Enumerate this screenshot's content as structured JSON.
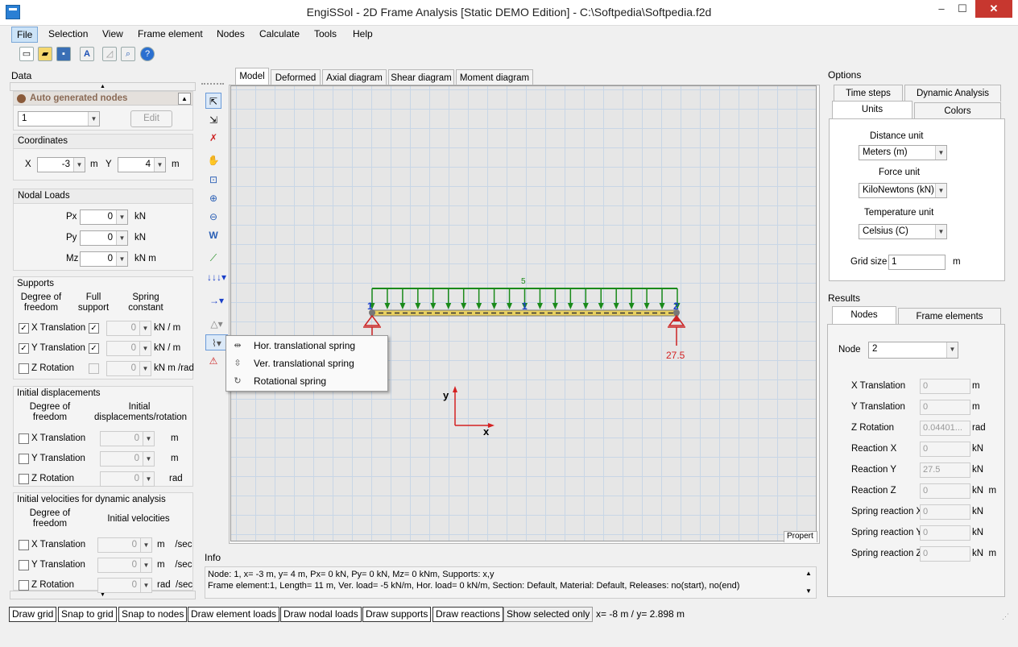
{
  "window": {
    "title": "EngiSSol - 2D Frame Analysis [Static DEMO Edition]   - C:\\Softpedia\\Softpedia.f2d",
    "min": "–",
    "max": "☐",
    "close": "✕"
  },
  "menu": [
    "File",
    "Selection",
    "View",
    "Frame element",
    "Nodes",
    "Calculate",
    "Tools",
    "Help"
  ],
  "toolbar": [
    "new-icon",
    "open-icon",
    "save-icon",
    "report-icon",
    "chart-icon",
    "print-preview-icon",
    "help-icon"
  ],
  "data_panel": {
    "title": "Data",
    "auto_nodes": {
      "label": "Auto generated nodes",
      "node_value": "1",
      "edit": "Edit"
    },
    "coordinates": {
      "title": "Coordinates",
      "x_label": "X",
      "x_value": "-3",
      "x_unit": "m",
      "y_label": "Y",
      "y_value": "4",
      "y_unit": "m"
    },
    "nodal_loads": {
      "title": "Nodal Loads",
      "rows": [
        {
          "label": "Px",
          "value": "0",
          "unit": "kN"
        },
        {
          "label": "Py",
          "value": "0",
          "unit": "kN"
        },
        {
          "label": "Mz",
          "value": "0",
          "unit": "kN  m"
        }
      ]
    },
    "supports": {
      "title": "Supports",
      "col1": "Degree of freedom",
      "col2": "Full support",
      "col3": "Spring constant",
      "rows": [
        {
          "label": "X Translation",
          "checked": true,
          "full": true,
          "value": "0",
          "unit": "kN  / m"
        },
        {
          "label": "Y Translation",
          "checked": true,
          "full": true,
          "value": "0",
          "unit": "kN  / m"
        },
        {
          "label": "Z Rotation",
          "checked": false,
          "full": false,
          "value": "0",
          "unit": "kN  m /rad"
        }
      ]
    },
    "initial_disp": {
      "title": "Initial displacements",
      "col1": "Degree of freedom",
      "col2": "Initial displacements/rotation",
      "rows": [
        {
          "label": "X Translation",
          "value": "0",
          "unit": "m"
        },
        {
          "label": "Y Translation",
          "value": "0",
          "unit": "m"
        },
        {
          "label": "Z Rotation",
          "value": "0",
          "unit": "rad"
        }
      ]
    },
    "initial_vel": {
      "title": "Initial velocities for dynamic analysis",
      "col1": "Degree of freedom",
      "col2": "Initial velocities",
      "rows": [
        {
          "label": "X Translation",
          "value": "0",
          "unit": "m    /sec"
        },
        {
          "label": "Y Translation",
          "value": "0",
          "unit": "m    /sec"
        },
        {
          "label": "Z Rotation",
          "value": "0",
          "unit": "rad  /sec"
        }
      ]
    }
  },
  "tabs": [
    "Model",
    "Deformed",
    "Axial diagram",
    "Shear diagram",
    "Moment diagram"
  ],
  "tools": [
    "pointer-icon",
    "select-frame-icon",
    "delete-icon",
    "pan-icon",
    "zoom-extents-icon",
    "zoom-in-icon",
    "zoom-out-icon",
    "zoom-window-icon",
    "draw-element-icon",
    "distributed-load-icon",
    "point-load-icon",
    "support-icon",
    "spring-icon",
    "reaction-icon"
  ],
  "context_menu": [
    {
      "icon": "horizontal-spring-icon",
      "label": "Hor. translational spring"
    },
    {
      "icon": "vertical-spring-icon",
      "label": "Ver. translational spring"
    },
    {
      "icon": "rotational-spring-icon",
      "label": "Rotational spring"
    }
  ],
  "canvas": {
    "load_value": "5",
    "node1": "1",
    "node2": "2",
    "element": "1",
    "reaction": "27.5",
    "axis_x": "x",
    "axis_y": "y",
    "properties_tab": "Propert"
  },
  "info": {
    "title": "Info",
    "line1": "Node: 1, x= -3 m, y= 4 m, Px= 0 kN, Py= 0 kN, Mz= 0 kNm, Supports: x,y",
    "line2": "Frame element:1, Length= 11 m, Ver. load= -5 kN/m, Hor. load= 0 kN/m, Section: Default, Material: Default, Releases: no(start), no(end)"
  },
  "options": {
    "title": "Options",
    "tabs_top": [
      "Time steps",
      "Dynamic Analysis"
    ],
    "tabs_bottom": [
      "Units",
      "Colors"
    ],
    "distance_label": "Distance unit",
    "distance_value": "Meters (m)",
    "force_label": "Force unit",
    "force_value": "KiloNewtons (kN)",
    "temp_label": "Temperature unit",
    "temp_value": "Celsius (C)",
    "grid_label": "Grid size",
    "grid_value": "1",
    "grid_unit": "m"
  },
  "results": {
    "title": "Results",
    "tabs": [
      "Nodes",
      "Frame elements"
    ],
    "node_label": "Node",
    "node_value": "2",
    "rows": [
      {
        "label": "X Translation",
        "value": "0",
        "unit": "m"
      },
      {
        "label": "Y Translation",
        "value": "0",
        "unit": "m"
      },
      {
        "label": "Z Rotation",
        "value": "0.04401...",
        "unit": "rad"
      },
      {
        "label": "Reaction X",
        "value": "0",
        "unit": "kN"
      },
      {
        "label": "Reaction Y",
        "value": "27.5",
        "unit": "kN"
      },
      {
        "label": "Reaction Z",
        "value": "0",
        "unit": "kN  m"
      },
      {
        "label": "Spring reaction X",
        "value": "0",
        "unit": "kN"
      },
      {
        "label": "Spring reaction Y",
        "value": "0",
        "unit": "kN"
      },
      {
        "label": "Spring reaction Z",
        "value": "0",
        "unit": "kN  m"
      }
    ]
  },
  "statusbar": {
    "buttons": [
      "Draw grid",
      "Snap to grid",
      "Snap to nodes",
      "Draw element loads",
      "Draw nodal loads",
      "Draw supports",
      "Draw reactions",
      "Show selected only"
    ],
    "coords": "x= -8 m / y= 2.898 m"
  },
  "colors": {
    "load": "#1a8a1a",
    "node": "#1a3fc8",
    "support": "#d42020",
    "beam": "#c8a000"
  }
}
